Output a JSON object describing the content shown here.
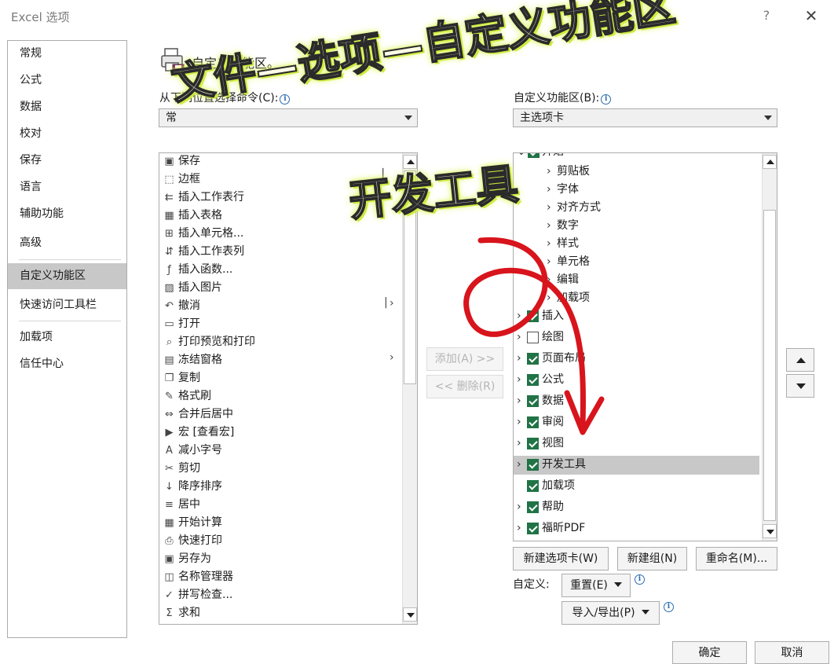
{
  "window": {
    "title": "Excel 选项",
    "help_glyph": "?",
    "close_glyph": "✕"
  },
  "nav": {
    "items": [
      {
        "label": "常规"
      },
      {
        "label": "公式"
      },
      {
        "label": "数据"
      },
      {
        "label": "校对"
      },
      {
        "label": "保存"
      },
      {
        "label": "语言"
      },
      {
        "label": "辅助功能"
      },
      {
        "label": "高级"
      },
      {
        "label": "自定义功能区",
        "selected": true
      },
      {
        "label": "快速访问工具栏"
      },
      {
        "label": "加载项"
      },
      {
        "label": "信任中心"
      }
    ]
  },
  "header": {
    "title": "自定义功能区。"
  },
  "left": {
    "choose_label": "从下列位置选择命令(C):",
    "combo_value": "常",
    "commands": [
      {
        "icon": "save-icon",
        "glyph": "▣",
        "label": "保存"
      },
      {
        "icon": "border-icon",
        "glyph": "⬚",
        "label": "边框",
        "submenu": "▏"
      },
      {
        "icon": "insert-row-icon",
        "glyph": "⇇",
        "label": "插入工作表行"
      },
      {
        "icon": "table-icon",
        "glyph": "▦",
        "label": "插入表格"
      },
      {
        "icon": "insert-cell-icon",
        "glyph": "⊞",
        "label": "插入单元格..."
      },
      {
        "icon": "insert-column-icon",
        "glyph": "⇵",
        "label": "插入工作表列"
      },
      {
        "icon": "function-icon",
        "glyph": "ƒ",
        "label": "插入函数..."
      },
      {
        "icon": "picture-icon",
        "glyph": "▨",
        "label": "插入图片"
      },
      {
        "icon": "undo-icon",
        "glyph": "↶",
        "label": "撤消",
        "submenu": "|›"
      },
      {
        "icon": "open-folder-icon",
        "glyph": "▭",
        "label": "打开"
      },
      {
        "icon": "print-preview-icon",
        "glyph": "⌕",
        "label": "打印预览和打印"
      },
      {
        "icon": "freeze-panes-icon",
        "glyph": "▤",
        "label": "冻结窗格",
        "submenu": "›"
      },
      {
        "icon": "copy-icon",
        "glyph": "❐",
        "label": "复制"
      },
      {
        "icon": "format-painter-icon",
        "glyph": "✎",
        "label": "格式刷"
      },
      {
        "icon": "merge-center-icon",
        "glyph": "⇔",
        "label": "合并后居中"
      },
      {
        "icon": "macro-icon",
        "glyph": "▶",
        "label": "宏 [查看宏]"
      },
      {
        "icon": "decrease-font-icon",
        "glyph": "A",
        "label": "减小字号"
      },
      {
        "icon": "cut-icon",
        "glyph": "✂",
        "label": "剪切"
      },
      {
        "icon": "sort-desc-icon",
        "glyph": "↓",
        "label": "降序排序"
      },
      {
        "icon": "align-center-icon",
        "glyph": "≡",
        "label": "居中"
      },
      {
        "icon": "calculator-icon",
        "glyph": "▦",
        "label": "开始计算"
      },
      {
        "icon": "quick-print-icon",
        "glyph": "⎙",
        "label": "快速打印"
      },
      {
        "icon": "save-as-icon",
        "glyph": "▣",
        "label": "另存为"
      },
      {
        "icon": "name-manager-icon",
        "glyph": "◫",
        "label": "名称管理器"
      },
      {
        "icon": "spellcheck-icon",
        "glyph": "✓",
        "label": "拼写检查..."
      },
      {
        "icon": "sum-icon",
        "glyph": "Σ",
        "label": "求和"
      }
    ]
  },
  "middle": {
    "add_label": "添加(A) >>",
    "remove_label": "<< 删除(R)"
  },
  "right": {
    "customize_label": "自定义功能区(B):",
    "combo_value": "主选项卡",
    "top_partial": "开始",
    "groups": [
      {
        "label": "剪贴板"
      },
      {
        "label": "字体"
      },
      {
        "label": "对齐方式"
      },
      {
        "label": "数字"
      },
      {
        "label": "样式"
      },
      {
        "label": "单元格"
      },
      {
        "label": "编辑"
      },
      {
        "label": "加载项"
      }
    ],
    "tabs": [
      {
        "label": "插入",
        "checked": true,
        "expand": true
      },
      {
        "label": "绘图",
        "checked": false,
        "expand": true
      },
      {
        "label": "页面布局",
        "checked": true,
        "expand": true
      },
      {
        "label": "公式",
        "checked": true,
        "expand": true
      },
      {
        "label": "数据",
        "checked": true,
        "expand": true
      },
      {
        "label": "审阅",
        "checked": true,
        "expand": true
      },
      {
        "label": "视图",
        "checked": true,
        "expand": true
      },
      {
        "label": "开发工具",
        "checked": true,
        "expand": true,
        "selected": true
      },
      {
        "label": "加载项",
        "checked": true,
        "expand": false
      },
      {
        "label": "帮助",
        "checked": true,
        "expand": true
      },
      {
        "label": "福昕PDF",
        "checked": true,
        "expand": true
      }
    ],
    "new_tab": "新建选项卡(W)",
    "new_group": "新建组(N)",
    "rename": "重命名(M)...",
    "custom_label": "自定义:",
    "reset": "重置(E)",
    "import_export": "导入/导出(P)"
  },
  "footer": {
    "ok": "确定",
    "cancel": "取消"
  },
  "overlay": {
    "line1": "文件—选项—自定义功能区",
    "line2": "开发工具"
  },
  "colors": {
    "checkbox": "#217346",
    "selection": "#c8c8c8",
    "arrow": "#d8141c"
  }
}
